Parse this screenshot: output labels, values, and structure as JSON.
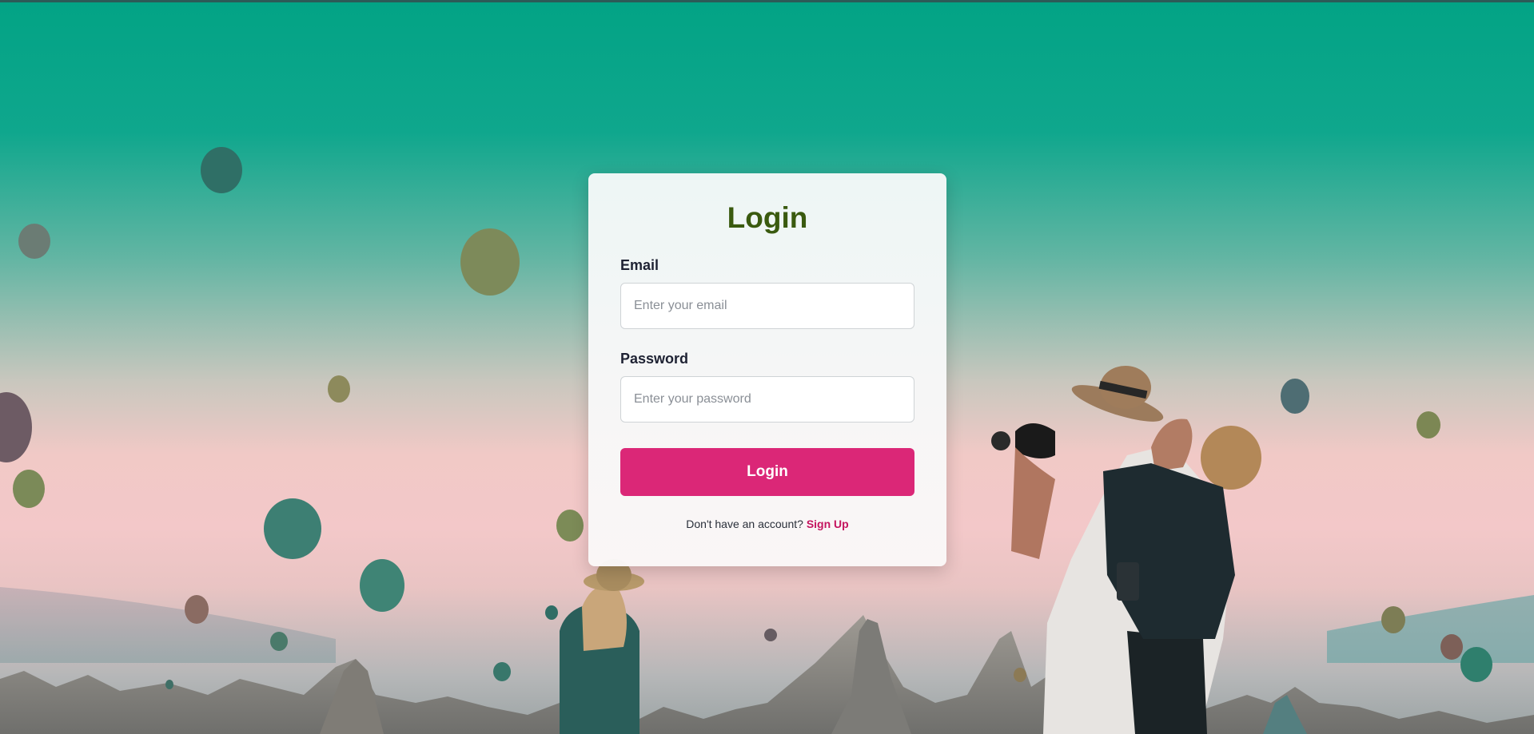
{
  "login": {
    "title": "Login",
    "email_label": "Email",
    "email_placeholder": "Enter your email",
    "password_label": "Password",
    "password_placeholder": "Enter your password",
    "submit_label": "Login",
    "signup_prompt": "Don't have an account?",
    "signup_link": "Sign Up"
  },
  "colors": {
    "accent": "#db2777",
    "title": "#3a5a0f",
    "sky_top": "#02a385",
    "sky_bottom": "#f3c8c9"
  }
}
